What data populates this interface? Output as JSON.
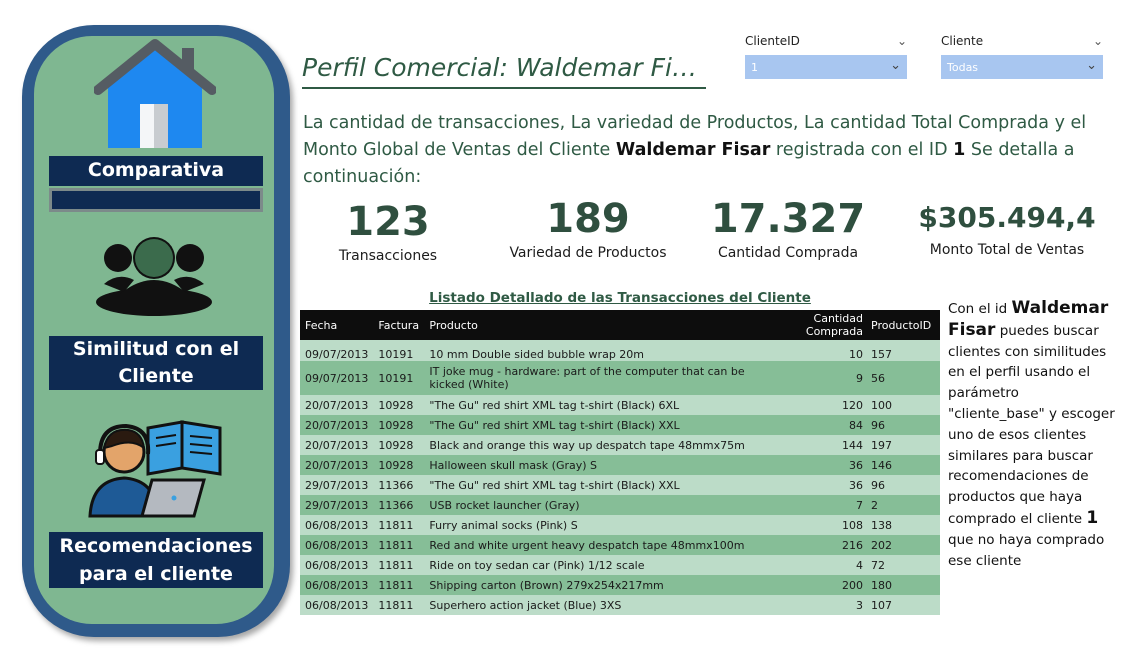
{
  "sidebar": {
    "nav": [
      {
        "label": "Comparativa",
        "icon": "home-icon"
      },
      {
        "label": "Similitud con el Cliente",
        "icon": "users-icon"
      },
      {
        "label": "Recomendaciones para el cliente",
        "icon": "support-agent-icon"
      }
    ]
  },
  "header": {
    "title": "Perfil Comercial: Waldemar Fis…"
  },
  "filters": {
    "cliente_id": {
      "label": "ClienteID",
      "value": "1"
    },
    "cliente": {
      "label": "Cliente",
      "value": "Todas"
    }
  },
  "description": {
    "part1": "La cantidad de transacciones, La variedad de Productos, La cantidad Total Comprada y el Monto Global de Ventas del Cliente ",
    "client_name": "Waldemar Fisar",
    "part2": " registrada con el ID ",
    "client_id": "1",
    "part3": " Se detalla a continuación:"
  },
  "kpis": [
    {
      "value": "123",
      "label": "Transacciones"
    },
    {
      "value": "189",
      "label": "Variedad de Productos"
    },
    {
      "value": "17.327",
      "label": "Cantidad Comprada"
    },
    {
      "value": "$305.494,4",
      "label": "Monto Total de Ventas"
    }
  ],
  "table": {
    "title": "Listado Detallado de las Transacciones del Cliente",
    "columns": [
      "Fecha",
      "Factura",
      "Producto",
      "Cantidad Comprada",
      "ProductoID"
    ],
    "rows": [
      [
        "09/07/2013",
        "10191",
        "10 mm Double sided bubble wrap 20m",
        "10",
        "157"
      ],
      [
        "09/07/2013",
        "10191",
        "IT joke mug - hardware: part of the computer that can be kicked (White)",
        "9",
        "56"
      ],
      [
        "20/07/2013",
        "10928",
        "\"The Gu\" red shirt XML tag t-shirt (Black) 6XL",
        "120",
        "100"
      ],
      [
        "20/07/2013",
        "10928",
        "\"The Gu\" red shirt XML tag t-shirt (Black) XXL",
        "84",
        "96"
      ],
      [
        "20/07/2013",
        "10928",
        "Black and orange this way up despatch tape 48mmx75m",
        "144",
        "197"
      ],
      [
        "20/07/2013",
        "10928",
        "Halloween skull mask (Gray) S",
        "36",
        "146"
      ],
      [
        "29/07/2013",
        "11366",
        "\"The Gu\" red shirt XML tag t-shirt (Black) XXL",
        "36",
        "96"
      ],
      [
        "29/07/2013",
        "11366",
        "USB rocket launcher (Gray)",
        "7",
        "2"
      ],
      [
        "06/08/2013",
        "11811",
        "Furry animal socks (Pink) S",
        "108",
        "138"
      ],
      [
        "06/08/2013",
        "11811",
        "Red and white urgent heavy despatch tape 48mmx100m",
        "216",
        "202"
      ],
      [
        "06/08/2013",
        "11811",
        "Ride on toy sedan car (Pink) 1/12 scale",
        "4",
        "72"
      ],
      [
        "06/08/2013",
        "11811",
        "Shipping carton (Brown) 279x254x217mm",
        "200",
        "180"
      ],
      [
        "06/08/2013",
        "11811",
        "Superhero action jacket (Blue) 3XS",
        "3",
        "107"
      ]
    ]
  },
  "note": {
    "part1": "Con el id ",
    "client_name": "Waldemar Fisar",
    "part2": " puedes buscar clientes con similitudes en el perfil usando el parámetro \"cliente_base\" y escoger uno de esos clientes similares para buscar recomendaciones de productos que haya comprado el cliente ",
    "client_id": "1",
    "part3": " que no haya comprado ese cliente"
  },
  "colors": {
    "sidebar_border": "#2f5a8a",
    "sidebar_fill": "#7fb791",
    "nav_label_bg": "#0e2a52",
    "row_light": "#bcdcc8",
    "row_dark": "#86be97",
    "header_bg": "#0d0d0d",
    "text_green": "#2f5a44"
  }
}
